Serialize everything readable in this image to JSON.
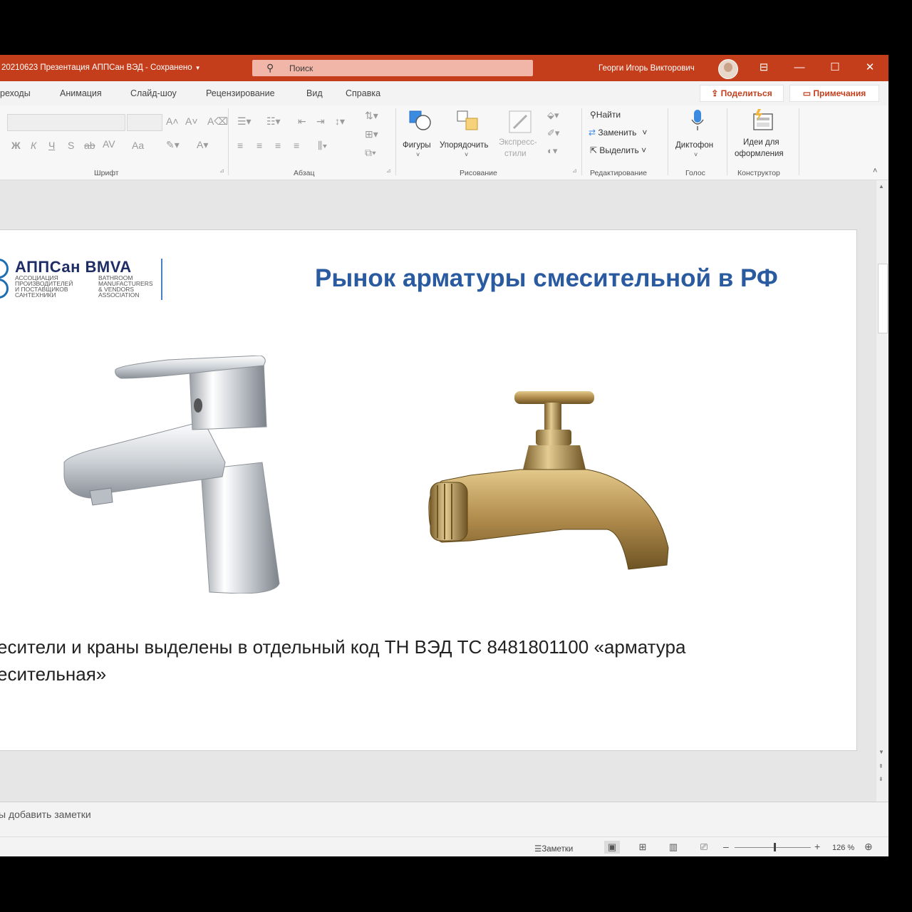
{
  "titlebar": {
    "doc_title": "20210623 Презентация АППСан ВЭД  -  Сохранено",
    "search_placeholder": "Поиск",
    "user_name": "Георги Игорь Викторович"
  },
  "tabs": {
    "items": [
      "реходы",
      "Анимация",
      "Слайд-шоу",
      "Рецензирование",
      "Вид",
      "Справка"
    ],
    "share_label": "Поделиться",
    "comments_label": "Примечания"
  },
  "ribbon": {
    "groups": {
      "font": "Шрифт",
      "paragraph": "Абзац",
      "drawing": "Рисование",
      "editing": "Редактирование",
      "voice": "Голос",
      "designer": "Конструктор"
    },
    "font_buttons": [
      "Ж",
      "К",
      "Ч",
      "S",
      "ab",
      "AV",
      "Aa"
    ],
    "shapes_label": "Фигуры",
    "arrange_label": "Упорядочить",
    "quick_styles_line1": "Экспресс-",
    "quick_styles_line2": "стили",
    "find_label": "Найти",
    "replace_label": "Заменить",
    "select_label": "Выделить",
    "dictate_label": "Диктофон",
    "design_ideas_line1": "Идеи для",
    "design_ideas_line2": "оформления"
  },
  "slide": {
    "logo_name": "АППСан BMVA",
    "logo_ru": [
      "Ассоциация",
      "производителей",
      "и поставщиков",
      "сантехники"
    ],
    "logo_en": [
      "Bathroom",
      "manufacturers",
      "& vendors",
      "association"
    ],
    "title": "Рынок арматуры смесительной в РФ",
    "body_line1": "есители и краны выделены в отдельный код ТН ВЭД ТС 8481801100 «арматура",
    "body_line2": "есительная»"
  },
  "notes": {
    "placeholder": "ы добавить заметки"
  },
  "status": {
    "notes_label": "Заметки",
    "zoom_level": "126 %",
    "zoom_fraction": 0.52
  },
  "colors": {
    "accent": "#c43e1c",
    "title_blue": "#2a5aa0",
    "logo_navy": "#1e2d66"
  }
}
